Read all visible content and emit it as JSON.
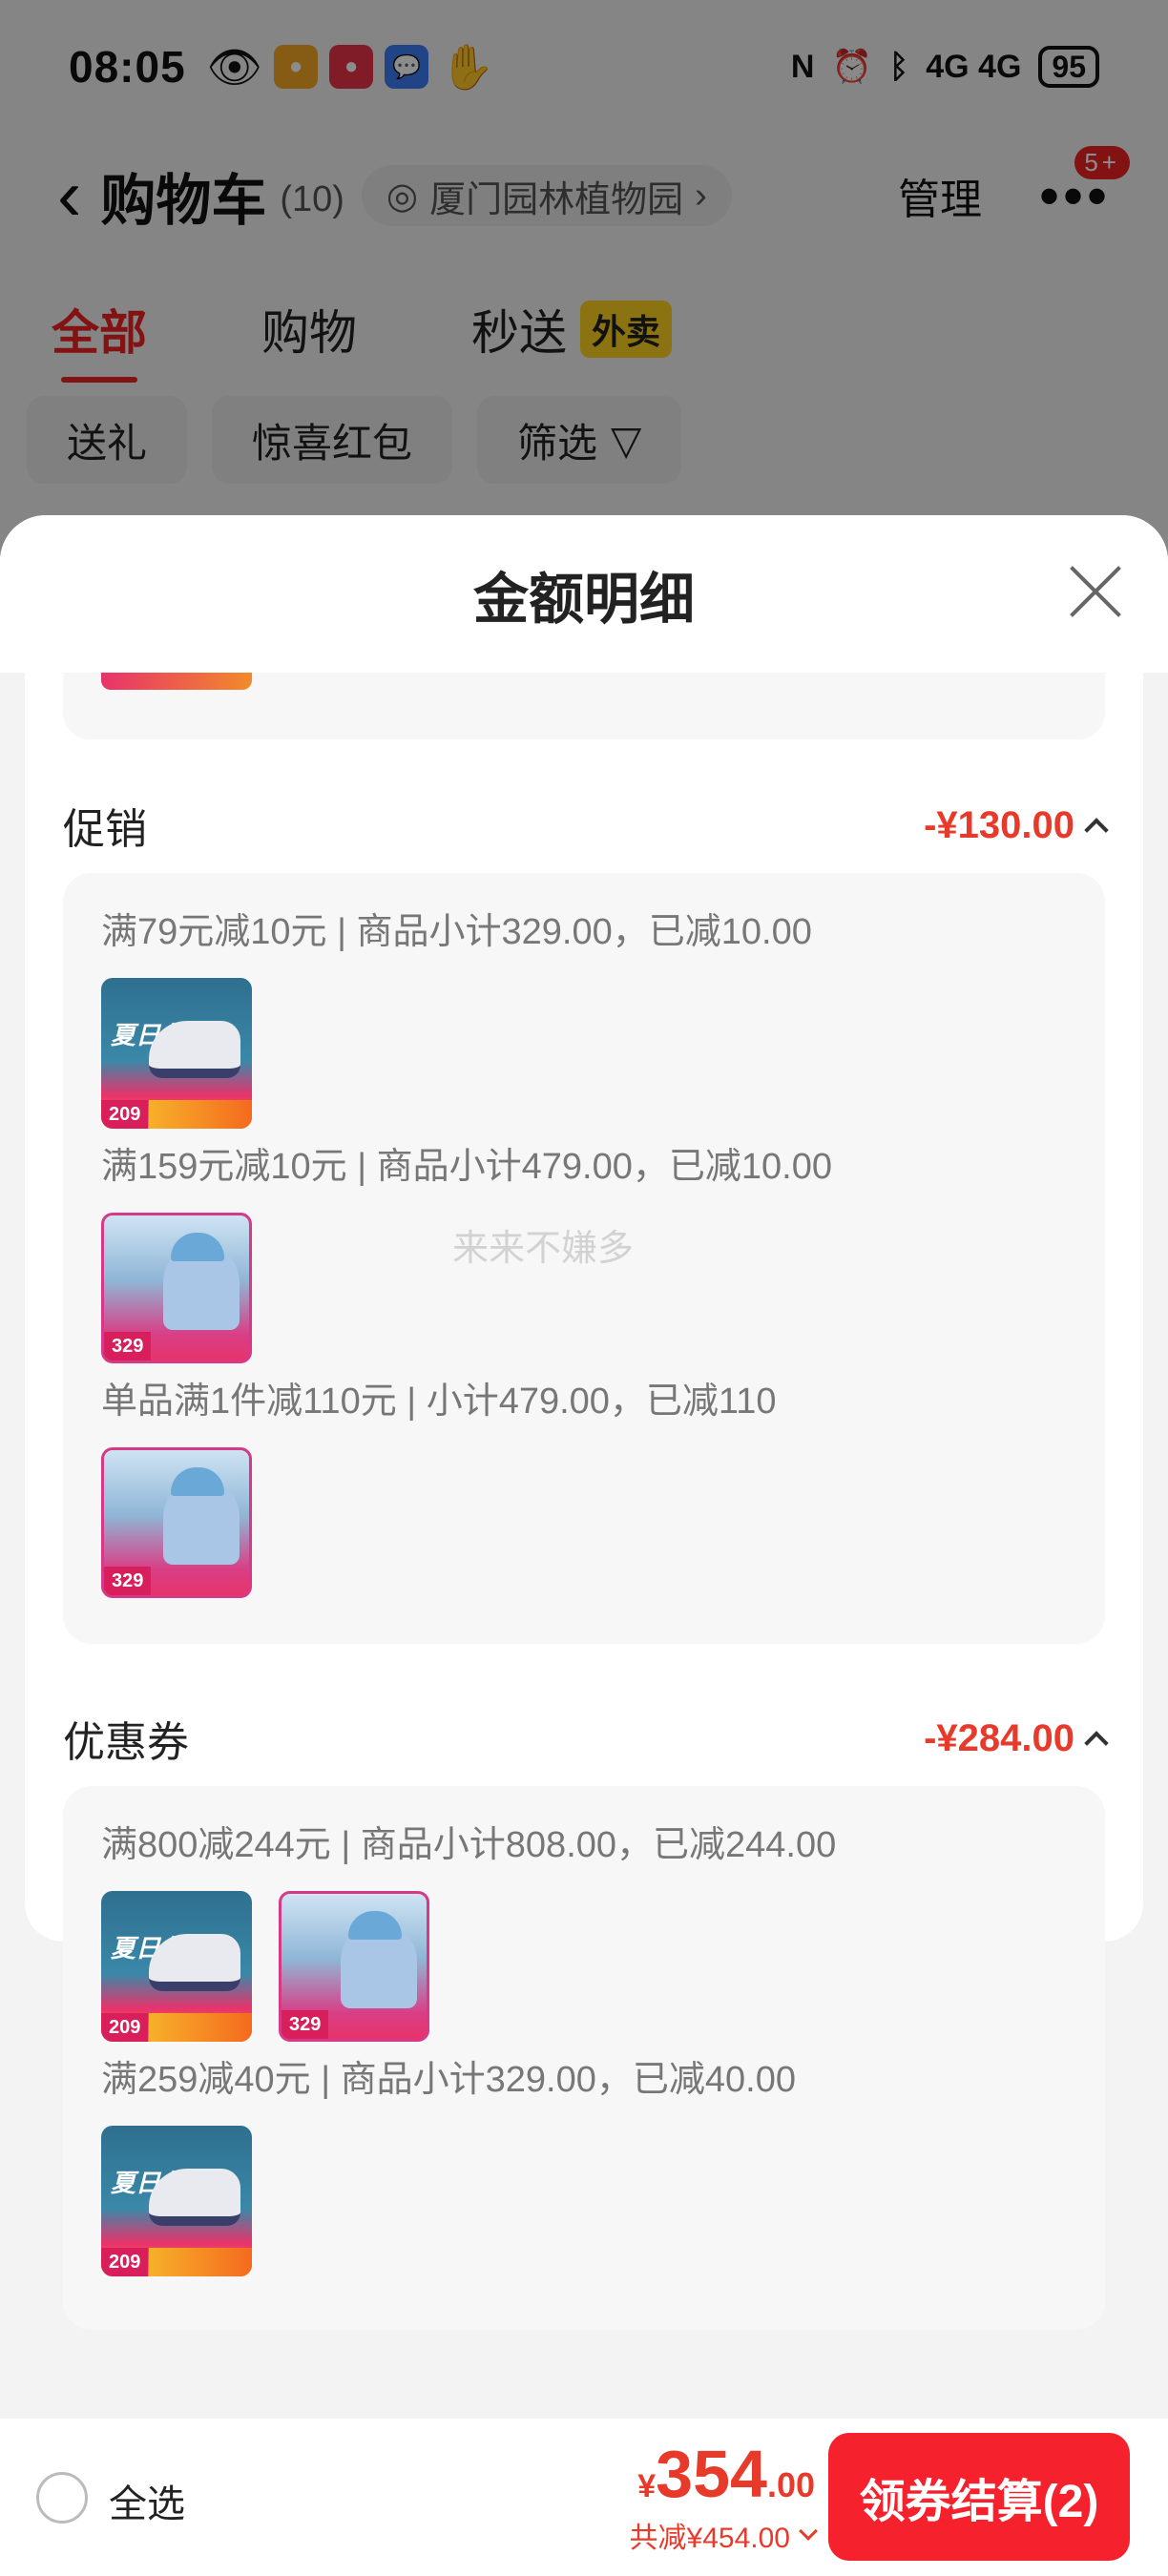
{
  "status_bar": {
    "time": "08:05",
    "network": "4G 4G",
    "battery": "95"
  },
  "nav": {
    "title": "购物车",
    "count": "(10)",
    "location": "厦门园林植物园",
    "manage": "管理",
    "more_badge": "5+"
  },
  "tabs": [
    {
      "label": "全部",
      "active": true
    },
    {
      "label": "购物",
      "active": false
    },
    {
      "label": "秒送",
      "badge": "外卖",
      "active": false
    }
  ],
  "chips": [
    "送礼",
    "惊喜红包",
    "筛选"
  ],
  "sheet": {
    "title": "金额明细",
    "promotion": {
      "label": "促销",
      "amount": "-¥130.00",
      "rules": [
        {
          "text": "满79元减10元 | 商品小计329.00，已减10.00",
          "thumbs": [
            "shoe"
          ]
        },
        {
          "text": "满159元减10元 | 商品小计479.00，已减10.00",
          "thumbs": [
            "kid"
          ]
        },
        {
          "text": "单品满1件减110元 | 小计479.00，已减110",
          "thumbs": [
            "kid"
          ]
        }
      ]
    },
    "coupon": {
      "label": "优惠券",
      "amount": "-¥284.00",
      "rules": [
        {
          "text": "满800减244元 | 商品小计808.00，已减244.00",
          "thumbs": [
            "shoe",
            "kid"
          ]
        },
        {
          "text": "满259减40元 | 商品小计329.00，已减40.00",
          "thumbs": [
            "shoe"
          ]
        }
      ]
    },
    "watermark": "来来不嫌多"
  },
  "thumbs": {
    "shoe_price": "209",
    "kid_price": "329",
    "shoe_headline": "夏日休闲"
  },
  "bottom": {
    "select_all": "全选",
    "currency": "¥",
    "total_int": "354",
    "total_dec": ".00",
    "saved": "共减¥454.00",
    "checkout": "领券结算(2)"
  },
  "colors": {
    "accent": "#e83a2b",
    "button": "#f5212d",
    "tab_badge": "#ffd21f"
  }
}
